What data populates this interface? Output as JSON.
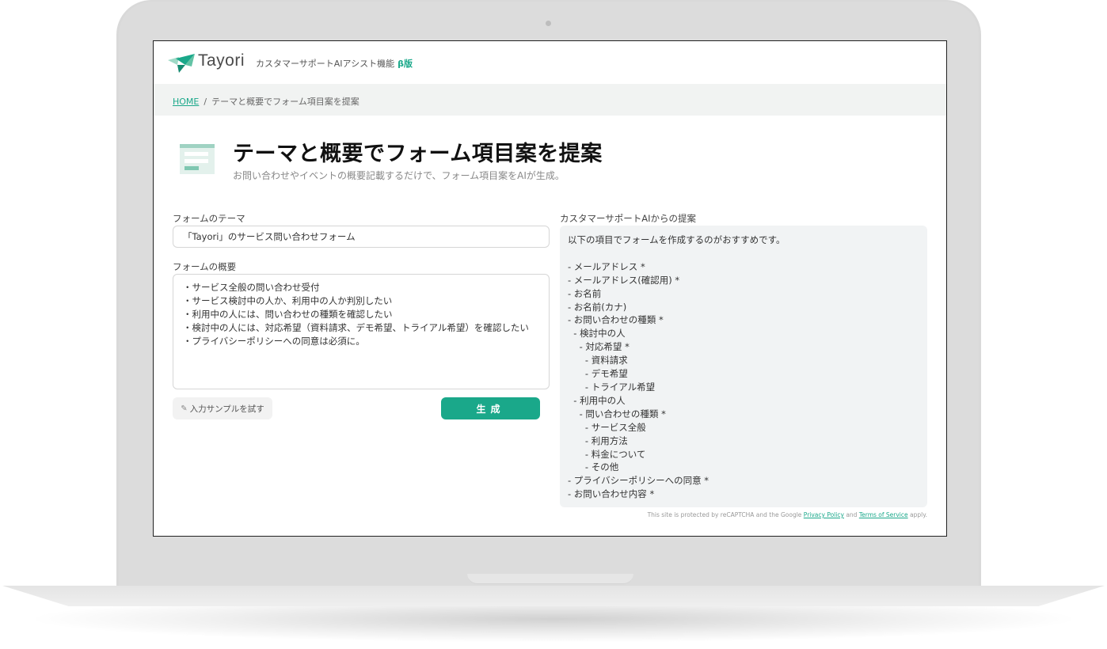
{
  "header": {
    "logo_text": "Tayori",
    "subtitle": "カスタマーサポートAIアシスト機能",
    "beta": "β版"
  },
  "breadcrumb": {
    "home": "HOME",
    "separator": "/",
    "current": "テーマと概要でフォーム項目案を提案"
  },
  "page": {
    "title": "テーマと概要でフォーム項目案を提案",
    "subtitle": "お問い合わせやイベントの概要記載するだけで、フォーム項目案をAIが生成。"
  },
  "form": {
    "theme_label": "フォームのテーマ",
    "theme_value": "「Tayori」のサービス問い合わせフォーム",
    "summary_label": "フォームの概要",
    "summary_lines": [
      "・サービス全般の問い合わせ受付",
      "・サービス検討中の人か、利用中の人か判別したい",
      "・利用中の人には、問い合わせの種類を確認したい",
      "・検討中の人には、対応希望（資料請求、デモ希望、トライアル希望）を確認したい",
      "・プライバシーポリシーへの同意は必須に。"
    ],
    "sample_button": "入力サンプルを試す",
    "generate_button": "生成"
  },
  "result": {
    "label": "カスタマーサポートAIからの提案",
    "lines": [
      "以下の項目でフォームを作成するのがおすすめです。",
      "",
      "- メールアドレス *",
      "- メールアドレス(確認用) *",
      "- お名前",
      "- お名前(カナ)",
      "- お問い合わせの種類 *",
      "  - 検討中の人",
      "    - 対応希望 *",
      "      - 資料請求",
      "      - デモ希望",
      "      - トライアル希望",
      "  - 利用中の人",
      "    - 問い合わせの種類 *",
      "      - サービス全般",
      "      - 利用方法",
      "      - 料金について",
      "      - その他",
      "- プライバシーポリシーへの同意 *",
      "- お問い合わせ内容 *"
    ]
  },
  "footer": {
    "recaptcha_prefix": "This site is protected by reCAPTCHA and the Google",
    "privacy_policy": "Privacy Policy",
    "and": "and",
    "terms": "Terms of Service",
    "suffix": "apply."
  },
  "colors": {
    "accent": "#1aa88a",
    "result_bg": "#f1f3f4",
    "breadcrumb_bg": "#f1f3f2"
  },
  "icons": {
    "logo": "tayori-bird-logo-icon",
    "page": "form-document-icon",
    "sample": "pencil-icon"
  }
}
